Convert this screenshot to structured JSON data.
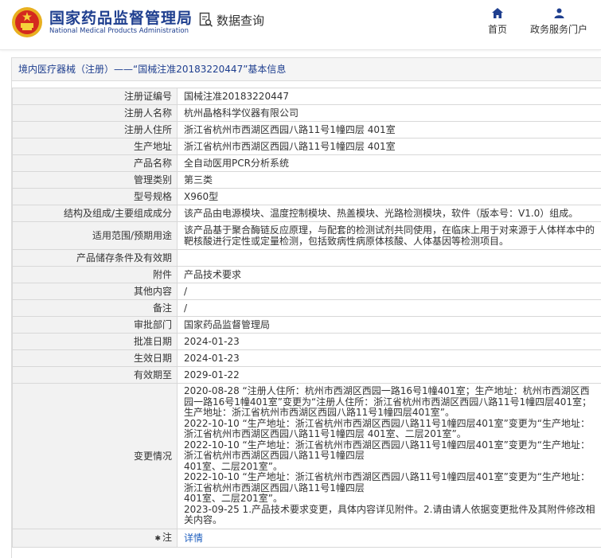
{
  "header": {
    "brand_cn": "国家药品监督管理局",
    "brand_en": "National Medical Products Administration",
    "query_label": "数据查询",
    "nav": [
      {
        "label": "首页",
        "icon": "home-icon"
      },
      {
        "label": "政务服务门户",
        "icon": "user-icon"
      }
    ]
  },
  "colors": {
    "brand": "#1f3f8f",
    "link": "#1f5fbf",
    "label_bg": "#f2f2f2"
  },
  "panel": {
    "title": "境内医疗器械（注册）——“国械注准20183220447”基本信息",
    "fields": [
      {
        "label": "注册证编号",
        "value": "国械注准20183220447"
      },
      {
        "label": "注册人名称",
        "value": "杭州晶格科学仪器有限公司"
      },
      {
        "label": "注册人住所",
        "value": "浙江省杭州市西湖区西园八路11号1幢四层 401室"
      },
      {
        "label": "生产地址",
        "value": "浙江省杭州市西湖区西园八路11号1幢四层 401室"
      },
      {
        "label": "产品名称",
        "value": "全自动医用PCR分析系统"
      },
      {
        "label": "管理类别",
        "value": "第三类"
      },
      {
        "label": "型号规格",
        "value": "X960型"
      },
      {
        "label": "结构及组成/主要组成成分",
        "value": "该产品由电源模块、温度控制模块、热盖模块、光路检测模块，软件（版本号：V1.0）组成。"
      },
      {
        "label": "适用范围/预期用途",
        "value": "该产品基于聚合酶链反应原理，与配套的检测试剂共同使用，在临床上用于对来源于人体样本中的靶核酸进行定性或定量检测，包括致病性病原体核酸、人体基因等检测项目。"
      },
      {
        "label": "产品储存条件及有效期",
        "value": ""
      },
      {
        "label": "附件",
        "value": "产品技术要求"
      },
      {
        "label": "其他内容",
        "value": "/"
      },
      {
        "label": "备注",
        "value": "/"
      },
      {
        "label": "审批部门",
        "value": "国家药品监督管理局"
      },
      {
        "label": "批准日期",
        "value": "2024-01-23"
      },
      {
        "label": "生效日期",
        "value": "2024-01-23"
      },
      {
        "label": "有效期至",
        "value": "2029-01-22"
      }
    ],
    "changes": {
      "label": "变更情况",
      "lines": [
        "2020-08-28 “注册人住所：杭州市西湖区西园一路16号1幢401室；生产地址：杭州市西湖区西园一路16号1幢401室”变更为“注册人住所：浙江省杭州市西湖区西园八路11号1幢四层401室；生产地址：浙江省杭州市西湖区西园八路11号1幢四层401室”。",
        "2022-10-10 “生产地址：浙江省杭州市西湖区西园八路11号1幢四层401室”变更为“生产地址：浙江省杭州市西湖区西园八路11号1幢四层 401室、二层201室”。",
        "2022-10-10 “生产地址：浙江省杭州市西湖区西园八路11号1幢四层401室”变更为“生产地址：浙江省杭州市西湖区西园八路11号1幢四层",
        "401室、二层201室”。",
        "2022-10-10 “生产地址：浙江省杭州市西湖区西园八路11号1幢四层401室”变更为“生产地址：浙江省杭州市西湖区西园八路11号1幢四层",
        "401室、二层201室”。",
        "2023-09-25 1.产品技术要求变更，具体内容详见附件。2.请由请人依据变更批件及其附件修改相关内容。"
      ]
    },
    "note": {
      "label": "注",
      "link": "详情"
    }
  }
}
